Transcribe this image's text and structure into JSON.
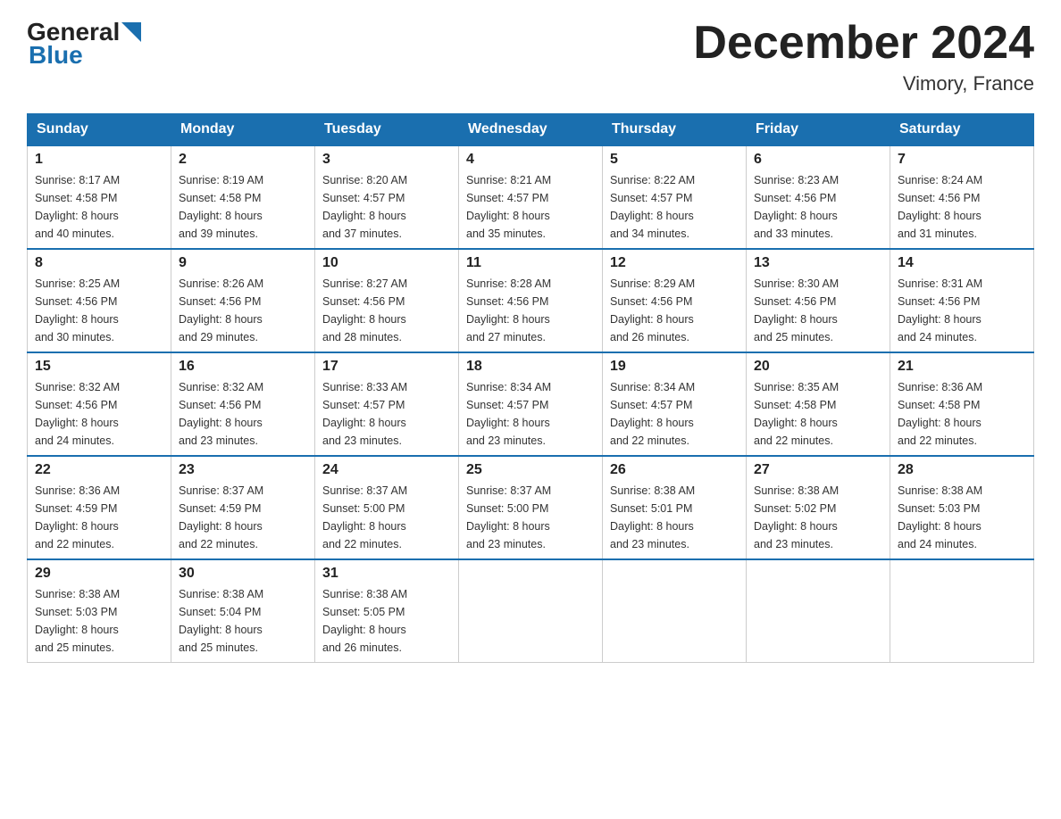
{
  "header": {
    "logo": {
      "general": "General",
      "blue": "Blue"
    },
    "title": "December 2024",
    "location": "Vimory, France"
  },
  "weekdays": [
    "Sunday",
    "Monday",
    "Tuesday",
    "Wednesday",
    "Thursday",
    "Friday",
    "Saturday"
  ],
  "weeks": [
    [
      {
        "day": "1",
        "sunrise": "8:17 AM",
        "sunset": "4:58 PM",
        "daylight": "8 hours and 40 minutes."
      },
      {
        "day": "2",
        "sunrise": "8:19 AM",
        "sunset": "4:58 PM",
        "daylight": "8 hours and 39 minutes."
      },
      {
        "day": "3",
        "sunrise": "8:20 AM",
        "sunset": "4:57 PM",
        "daylight": "8 hours and 37 minutes."
      },
      {
        "day": "4",
        "sunrise": "8:21 AM",
        "sunset": "4:57 PM",
        "daylight": "8 hours and 35 minutes."
      },
      {
        "day": "5",
        "sunrise": "8:22 AM",
        "sunset": "4:57 PM",
        "daylight": "8 hours and 34 minutes."
      },
      {
        "day": "6",
        "sunrise": "8:23 AM",
        "sunset": "4:56 PM",
        "daylight": "8 hours and 33 minutes."
      },
      {
        "day": "7",
        "sunrise": "8:24 AM",
        "sunset": "4:56 PM",
        "daylight": "8 hours and 31 minutes."
      }
    ],
    [
      {
        "day": "8",
        "sunrise": "8:25 AM",
        "sunset": "4:56 PM",
        "daylight": "8 hours and 30 minutes."
      },
      {
        "day": "9",
        "sunrise": "8:26 AM",
        "sunset": "4:56 PM",
        "daylight": "8 hours and 29 minutes."
      },
      {
        "day": "10",
        "sunrise": "8:27 AM",
        "sunset": "4:56 PM",
        "daylight": "8 hours and 28 minutes."
      },
      {
        "day": "11",
        "sunrise": "8:28 AM",
        "sunset": "4:56 PM",
        "daylight": "8 hours and 27 minutes."
      },
      {
        "day": "12",
        "sunrise": "8:29 AM",
        "sunset": "4:56 PM",
        "daylight": "8 hours and 26 minutes."
      },
      {
        "day": "13",
        "sunrise": "8:30 AM",
        "sunset": "4:56 PM",
        "daylight": "8 hours and 25 minutes."
      },
      {
        "day": "14",
        "sunrise": "8:31 AM",
        "sunset": "4:56 PM",
        "daylight": "8 hours and 24 minutes."
      }
    ],
    [
      {
        "day": "15",
        "sunrise": "8:32 AM",
        "sunset": "4:56 PM",
        "daylight": "8 hours and 24 minutes."
      },
      {
        "day": "16",
        "sunrise": "8:32 AM",
        "sunset": "4:56 PM",
        "daylight": "8 hours and 23 minutes."
      },
      {
        "day": "17",
        "sunrise": "8:33 AM",
        "sunset": "4:57 PM",
        "daylight": "8 hours and 23 minutes."
      },
      {
        "day": "18",
        "sunrise": "8:34 AM",
        "sunset": "4:57 PM",
        "daylight": "8 hours and 23 minutes."
      },
      {
        "day": "19",
        "sunrise": "8:34 AM",
        "sunset": "4:57 PM",
        "daylight": "8 hours and 22 minutes."
      },
      {
        "day": "20",
        "sunrise": "8:35 AM",
        "sunset": "4:58 PM",
        "daylight": "8 hours and 22 minutes."
      },
      {
        "day": "21",
        "sunrise": "8:36 AM",
        "sunset": "4:58 PM",
        "daylight": "8 hours and 22 minutes."
      }
    ],
    [
      {
        "day": "22",
        "sunrise": "8:36 AM",
        "sunset": "4:59 PM",
        "daylight": "8 hours and 22 minutes."
      },
      {
        "day": "23",
        "sunrise": "8:37 AM",
        "sunset": "4:59 PM",
        "daylight": "8 hours and 22 minutes."
      },
      {
        "day": "24",
        "sunrise": "8:37 AM",
        "sunset": "5:00 PM",
        "daylight": "8 hours and 22 minutes."
      },
      {
        "day": "25",
        "sunrise": "8:37 AM",
        "sunset": "5:00 PM",
        "daylight": "8 hours and 23 minutes."
      },
      {
        "day": "26",
        "sunrise": "8:38 AM",
        "sunset": "5:01 PM",
        "daylight": "8 hours and 23 minutes."
      },
      {
        "day": "27",
        "sunrise": "8:38 AM",
        "sunset": "5:02 PM",
        "daylight": "8 hours and 23 minutes."
      },
      {
        "day": "28",
        "sunrise": "8:38 AM",
        "sunset": "5:03 PM",
        "daylight": "8 hours and 24 minutes."
      }
    ],
    [
      {
        "day": "29",
        "sunrise": "8:38 AM",
        "sunset": "5:03 PM",
        "daylight": "8 hours and 25 minutes."
      },
      {
        "day": "30",
        "sunrise": "8:38 AM",
        "sunset": "5:04 PM",
        "daylight": "8 hours and 25 minutes."
      },
      {
        "day": "31",
        "sunrise": "8:38 AM",
        "sunset": "5:05 PM",
        "daylight": "8 hours and 26 minutes."
      },
      null,
      null,
      null,
      null
    ]
  ],
  "labels": {
    "sunrise": "Sunrise:",
    "sunset": "Sunset:",
    "daylight": "Daylight:"
  }
}
